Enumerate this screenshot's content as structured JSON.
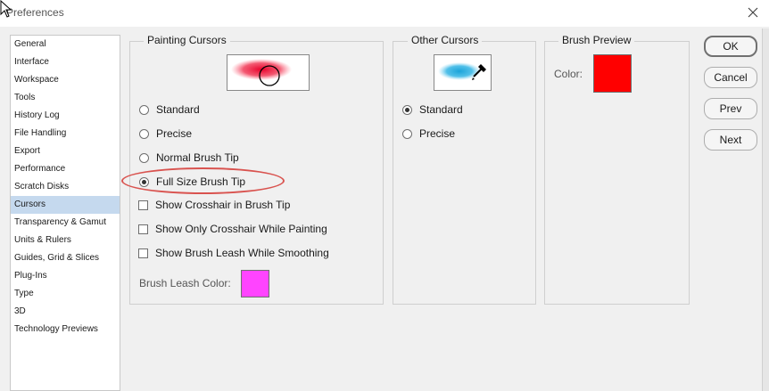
{
  "window": {
    "title": "Preferences"
  },
  "sidebar": {
    "items": [
      {
        "label": "General"
      },
      {
        "label": "Interface"
      },
      {
        "label": "Workspace"
      },
      {
        "label": "Tools"
      },
      {
        "label": "History Log"
      },
      {
        "label": "File Handling"
      },
      {
        "label": "Export"
      },
      {
        "label": "Performance"
      },
      {
        "label": "Scratch Disks"
      },
      {
        "label": "Cursors",
        "selected": true
      },
      {
        "label": "Transparency & Gamut"
      },
      {
        "label": "Units & Rulers"
      },
      {
        "label": "Guides, Grid & Slices"
      },
      {
        "label": "Plug-Ins"
      },
      {
        "label": "Type"
      },
      {
        "label": "3D"
      },
      {
        "label": "Technology Previews"
      }
    ]
  },
  "painting_cursors": {
    "legend": "Painting Cursors",
    "options": [
      {
        "label": "Standard",
        "checked": false
      },
      {
        "label": "Precise",
        "checked": false
      },
      {
        "label": "Normal Brush Tip",
        "checked": false
      },
      {
        "label": "Full Size Brush Tip",
        "checked": true
      }
    ],
    "checkboxes": [
      {
        "label": "Show Crosshair in Brush Tip",
        "checked": false
      },
      {
        "label": "Show Only Crosshair While Painting",
        "checked": false
      },
      {
        "label": "Show Brush Leash While Smoothing",
        "checked": false
      }
    ],
    "leash_color_label": "Brush Leash Color:",
    "leash_color": "#ff44ff"
  },
  "other_cursors": {
    "legend": "Other Cursors",
    "options": [
      {
        "label": "Standard",
        "checked": true
      },
      {
        "label": "Precise",
        "checked": false
      }
    ]
  },
  "brush_preview": {
    "legend": "Brush Preview",
    "color_label": "Color:",
    "color": "#ff0000"
  },
  "buttons": {
    "ok": "OK",
    "cancel": "Cancel",
    "prev": "Prev",
    "next": "Next"
  }
}
